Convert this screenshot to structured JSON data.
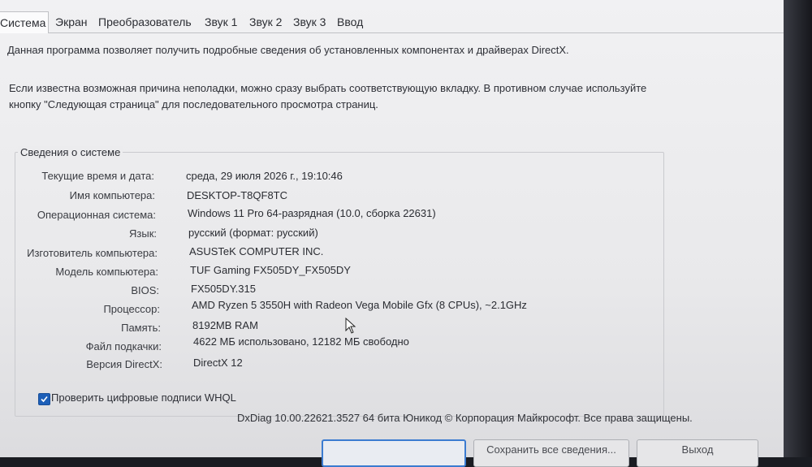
{
  "tabs": [
    "Система",
    "Экран",
    "Преобразователь",
    "Звук 1",
    "Звук 2",
    "Звук 3",
    "Ввод"
  ],
  "intro_text_1": "Данная программа позволяет получить подробные сведения об установленных компонентах и драйверах DirectX.",
  "intro_text_2_line1": "Если известна возможная причина неполадки, можно сразу выбрать соответствующую вкладку. В противном случае используйте",
  "intro_text_2_line2": "кнопку \"Следующая страница\" для последовательного просмотра страниц.",
  "system_info": {
    "title": "Сведения о системе",
    "rows": [
      {
        "label": "Текущие время и дата:",
        "value": "среда, 29 июля 2026 г., 19:10:46"
      },
      {
        "label": "Имя компьютера:",
        "value": "DESKTOP-T8QF8TC"
      },
      {
        "label": "Операционная система:",
        "value": "Windows 11 Pro 64-разрядная (10.0, сборка 22631)"
      },
      {
        "label": "Язык:",
        "value": "русский (формат: русский)"
      },
      {
        "label": "Изготовитель компьютера:",
        "value": "ASUSTeK COMPUTER INC."
      },
      {
        "label": "Модель компьютера:",
        "value": "TUF Gaming FX505DY_FX505DY"
      },
      {
        "label": "BIOS:",
        "value": "FX505DY.315"
      },
      {
        "label": "Процессор:",
        "value": "AMD Ryzen 5 3550H with Radeon Vega Mobile Gfx   (8 CPUs), ~2.1GHz"
      },
      {
        "label": "Память:",
        "value": "8192MB RAM"
      },
      {
        "label": "Файл подкачки:",
        "value": "4622 МБ использовано, 12182 МБ свободно"
      },
      {
        "label": "Версия DirectX:",
        "value": "DirectX 12"
      }
    ]
  },
  "whql_checkbox": {
    "label": "Проверить цифровые подписи WHQL",
    "checked": true
  },
  "footer_text": "DxDiag 10.00.22621.3527 64 бита Юникод © Корпорация Майкрософт. Все права защищены.",
  "buttons": {
    "save_all": "Сохранить все сведения...",
    "exit": "Выход"
  }
}
